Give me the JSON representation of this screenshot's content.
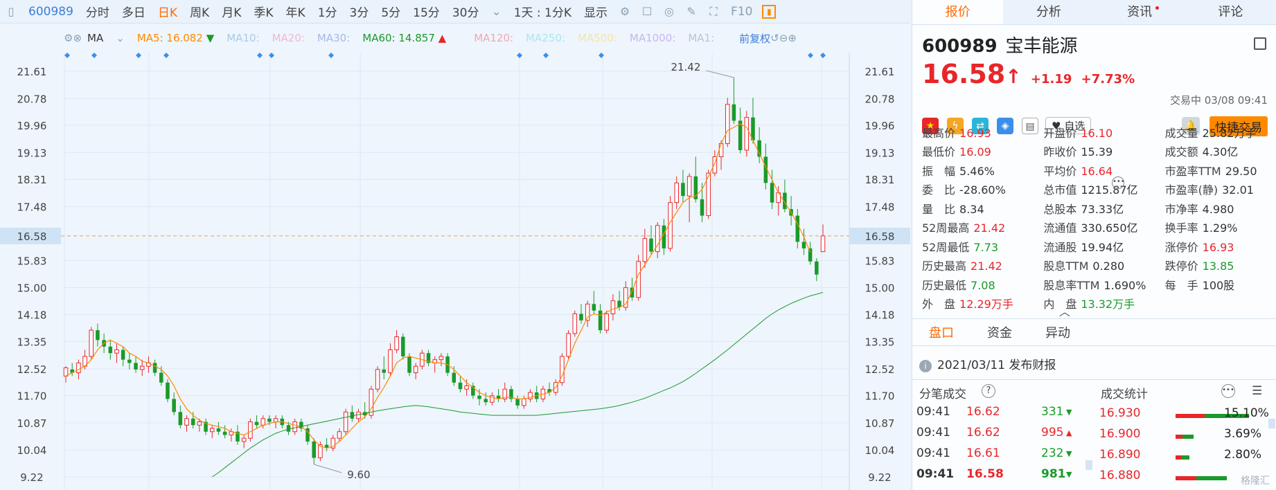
{
  "toolbar": {
    "code": "600989",
    "tabs": [
      "分时",
      "多日",
      "日K",
      "周K",
      "月K",
      "季K",
      "年K",
      "1分",
      "3分",
      "5分",
      "15分",
      "30分"
    ],
    "active": "日K",
    "range": "1天 : 1分K",
    "display": "显示",
    "f10": "F10"
  },
  "ma": {
    "label": "MA",
    "ma5": {
      "label": "MA5:",
      "value": "16.082",
      "color": "#ff8a00"
    },
    "ma10": "MA10:",
    "ma20": "MA20:",
    "ma30": "MA30:",
    "ma60": {
      "label": "MA60:",
      "value": "14.857",
      "color": "#1a9a2a"
    },
    "ma120": "MA120:",
    "ma250": "MA250:",
    "ma500": "MA500:",
    "ma1000": "MA1000:",
    "ma1": "MA1:",
    "adjust": "前复权"
  },
  "axis": {
    "levels": [
      "21.61",
      "20.78",
      "19.96",
      "19.13",
      "18.31",
      "17.48",
      "16.58",
      "15.83",
      "15.00",
      "14.18",
      "13.35",
      "12.52",
      "11.70",
      "10.87",
      "10.04",
      "9.22"
    ],
    "current": "16.58",
    "high_mark": "21.42",
    "low_mark": "9.60"
  },
  "chart_data": {
    "type": "candlestick",
    "symbol": "600989",
    "y_range": [
      9.22,
      21.61
    ],
    "current_price": 16.58,
    "annotations": {
      "max": 21.42,
      "min": 9.6
    },
    "candles": [
      [
        12.3,
        12.6,
        12.1,
        12.55
      ],
      [
        12.5,
        12.7,
        12.3,
        12.4
      ],
      [
        12.4,
        12.8,
        12.2,
        12.7
      ],
      [
        12.6,
        13.1,
        12.5,
        12.9
      ],
      [
        12.9,
        13.8,
        12.8,
        13.7
      ],
      [
        13.7,
        13.9,
        13.2,
        13.4
      ],
      [
        13.4,
        13.6,
        13.0,
        13.2
      ],
      [
        13.2,
        13.4,
        12.8,
        13.0
      ],
      [
        13.0,
        13.3,
        12.7,
        13.1
      ],
      [
        13.1,
        13.2,
        12.6,
        12.8
      ],
      [
        12.8,
        13.0,
        12.5,
        12.7
      ],
      [
        12.7,
        12.9,
        12.4,
        12.5
      ],
      [
        12.5,
        12.8,
        12.3,
        12.6
      ],
      [
        12.6,
        12.9,
        12.4,
        12.7
      ],
      [
        12.7,
        12.8,
        12.3,
        12.4
      ],
      [
        12.4,
        12.6,
        12.0,
        12.1
      ],
      [
        12.1,
        12.2,
        11.5,
        11.6
      ],
      [
        11.6,
        11.8,
        11.1,
        11.2
      ],
      [
        11.2,
        11.4,
        10.7,
        10.8
      ],
      [
        10.8,
        11.1,
        10.6,
        11.0
      ],
      [
        11.0,
        11.2,
        10.7,
        10.8
      ],
      [
        10.8,
        11.0,
        10.6,
        10.9
      ],
      [
        10.9,
        11.0,
        10.5,
        10.6
      ],
      [
        10.6,
        10.8,
        10.4,
        10.7
      ],
      [
        10.7,
        10.9,
        10.5,
        10.6
      ],
      [
        10.6,
        10.8,
        10.4,
        10.5
      ],
      [
        10.5,
        10.7,
        10.3,
        10.6
      ],
      [
        10.6,
        10.8,
        10.2,
        10.3
      ],
      [
        10.3,
        10.5,
        10.1,
        10.4
      ],
      [
        10.4,
        11.0,
        10.3,
        10.9
      ],
      [
        10.9,
        11.1,
        10.7,
        10.8
      ],
      [
        10.8,
        11.1,
        10.7,
        11.0
      ],
      [
        11.0,
        11.1,
        10.8,
        10.9
      ],
      [
        10.9,
        11.1,
        10.7,
        11.0
      ],
      [
        11.0,
        11.1,
        10.7,
        10.8
      ],
      [
        10.8,
        10.9,
        10.5,
        10.6
      ],
      [
        10.6,
        11.0,
        10.5,
        10.9
      ],
      [
        10.9,
        11.0,
        10.6,
        10.7
      ],
      [
        10.7,
        10.8,
        10.2,
        10.3
      ],
      [
        10.3,
        10.4,
        9.6,
        9.8
      ],
      [
        9.8,
        10.3,
        9.7,
        10.2
      ],
      [
        10.2,
        10.4,
        10.0,
        10.1
      ],
      [
        10.1,
        10.5,
        10.0,
        10.4
      ],
      [
        10.4,
        10.7,
        10.3,
        10.6
      ],
      [
        10.6,
        11.3,
        10.5,
        11.2
      ],
      [
        11.2,
        11.4,
        10.9,
        11.0
      ],
      [
        11.0,
        11.3,
        10.9,
        11.2
      ],
      [
        11.2,
        11.5,
        11.0,
        11.1
      ],
      [
        11.1,
        12.0,
        11.0,
        11.9
      ],
      [
        11.9,
        12.6,
        11.8,
        12.5
      ],
      [
        12.5,
        12.9,
        12.2,
        12.4
      ],
      [
        12.4,
        13.3,
        12.3,
        13.1
      ],
      [
        13.1,
        13.7,
        13.0,
        13.5
      ],
      [
        13.5,
        13.6,
        12.8,
        12.9
      ],
      [
        12.9,
        13.0,
        12.3,
        12.4
      ],
      [
        12.4,
        12.7,
        12.2,
        12.6
      ],
      [
        12.6,
        13.1,
        12.5,
        13.0
      ],
      [
        13.0,
        13.1,
        12.6,
        12.7
      ],
      [
        12.7,
        12.9,
        12.4,
        12.8
      ],
      [
        12.8,
        13.0,
        12.6,
        12.9
      ],
      [
        12.9,
        13.0,
        12.3,
        12.4
      ],
      [
        12.4,
        12.6,
        12.0,
        12.1
      ],
      [
        12.1,
        12.3,
        11.8,
        11.9
      ],
      [
        11.9,
        12.2,
        11.7,
        12.0
      ],
      [
        12.0,
        12.1,
        11.6,
        11.7
      ],
      [
        11.7,
        11.9,
        11.4,
        11.6
      ],
      [
        11.6,
        11.8,
        11.4,
        11.5
      ],
      [
        11.5,
        11.8,
        11.4,
        11.7
      ],
      [
        11.7,
        11.9,
        11.5,
        11.6
      ],
      [
        11.6,
        12.1,
        11.5,
        11.9
      ],
      [
        11.9,
        12.0,
        11.5,
        11.6
      ],
      [
        11.6,
        11.7,
        11.3,
        11.4
      ],
      [
        11.4,
        11.7,
        11.3,
        11.6
      ],
      [
        11.6,
        11.9,
        11.5,
        11.8
      ],
      [
        11.8,
        12.0,
        11.5,
        11.6
      ],
      [
        11.6,
        12.0,
        11.5,
        11.9
      ],
      [
        11.9,
        12.1,
        11.7,
        11.8
      ],
      [
        11.8,
        12.2,
        11.7,
        12.1
      ],
      [
        12.1,
        13.0,
        12.0,
        12.9
      ],
      [
        12.9,
        13.7,
        12.8,
        13.6
      ],
      [
        13.6,
        14.3,
        13.5,
        14.2
      ],
      [
        14.2,
        14.5,
        13.9,
        14.0
      ],
      [
        14.0,
        14.6,
        13.8,
        14.5
      ],
      [
        14.5,
        14.9,
        14.2,
        14.3
      ],
      [
        14.3,
        14.5,
        13.6,
        13.7
      ],
      [
        13.7,
        14.3,
        13.6,
        14.2
      ],
      [
        14.2,
        14.8,
        14.0,
        14.6
      ],
      [
        14.6,
        14.9,
        14.3,
        14.4
      ],
      [
        14.4,
        15.2,
        14.3,
        15.0
      ],
      [
        15.0,
        15.3,
        14.6,
        14.7
      ],
      [
        14.7,
        16.0,
        14.6,
        15.8
      ],
      [
        15.8,
        16.8,
        15.6,
        16.5
      ],
      [
        16.5,
        16.9,
        16.0,
        16.1
      ],
      [
        16.1,
        17.0,
        15.9,
        16.9
      ],
      [
        16.9,
        17.1,
        16.0,
        16.2
      ],
      [
        16.2,
        17.8,
        16.1,
        17.6
      ],
      [
        17.6,
        18.4,
        17.4,
        18.2
      ],
      [
        18.2,
        18.6,
        17.6,
        17.8
      ],
      [
        17.8,
        18.5,
        17.0,
        18.4
      ],
      [
        18.4,
        19.0,
        17.6,
        17.7
      ],
      [
        17.7,
        18.2,
        17.0,
        17.2
      ],
      [
        17.2,
        18.6,
        17.1,
        18.5
      ],
      [
        18.5,
        19.2,
        18.4,
        19.0
      ],
      [
        19.0,
        19.5,
        18.6,
        19.4
      ],
      [
        19.4,
        20.8,
        19.3,
        20.6
      ],
      [
        20.6,
        21.42,
        20.0,
        20.1
      ],
      [
        20.1,
        20.5,
        19.1,
        19.2
      ],
      [
        19.2,
        20.4,
        19.0,
        20.2
      ],
      [
        20.2,
        20.8,
        19.4,
        19.5
      ],
      [
        19.5,
        19.9,
        18.8,
        19.0
      ],
      [
        19.0,
        19.4,
        18.0,
        18.2
      ],
      [
        18.2,
        18.6,
        17.4,
        17.6
      ],
      [
        17.6,
        18.1,
        17.2,
        17.9
      ],
      [
        17.9,
        18.3,
        17.3,
        17.4
      ],
      [
        17.4,
        17.8,
        16.9,
        17.2
      ],
      [
        17.2,
        17.4,
        16.2,
        16.4
      ],
      [
        16.4,
        16.8,
        16.0,
        16.2
      ],
      [
        16.2,
        16.4,
        15.7,
        15.8
      ],
      [
        15.8,
        15.9,
        15.2,
        15.4
      ],
      [
        16.1,
        16.93,
        16.09,
        16.58
      ]
    ],
    "ma5": [
      12.3,
      12.4,
      12.5,
      12.6,
      12.8,
      13.1,
      13.3,
      13.4,
      13.3,
      13.2,
      13.0,
      12.9,
      12.75,
      12.7,
      12.6,
      12.5,
      12.3,
      12.0,
      11.6,
      11.3,
      11.1,
      10.95,
      10.85,
      10.8,
      10.75,
      10.7,
      10.6,
      10.55,
      10.5,
      10.6,
      10.7,
      10.8,
      10.85,
      10.9,
      10.9,
      10.85,
      10.8,
      10.75,
      10.6,
      10.35,
      10.15,
      10.1,
      10.15,
      10.3,
      10.5,
      10.7,
      10.9,
      11.05,
      11.3,
      11.65,
      11.95,
      12.3,
      12.7,
      12.85,
      12.9,
      12.85,
      12.8,
      12.75,
      12.7,
      12.7,
      12.65,
      12.5,
      12.3,
      12.1,
      11.95,
      11.8,
      11.7,
      11.65,
      11.6,
      11.65,
      11.65,
      11.6,
      11.6,
      11.65,
      11.7,
      11.75,
      11.8,
      11.95,
      12.3,
      12.8,
      13.3,
      13.7,
      14.1,
      14.2,
      14.15,
      14.25,
      14.35,
      14.4,
      14.5,
      14.9,
      15.4,
      15.7,
      16.0,
      16.3,
      16.65,
      17.0,
      17.3,
      17.6,
      17.75,
      17.8,
      18.0,
      18.4,
      18.8,
      19.4,
      19.8,
      19.9,
      20.0,
      19.9,
      19.5,
      19.1,
      18.7,
      18.3,
      17.9,
      17.6,
      17.3,
      16.95,
      16.55,
      16.08
    ],
    "ma60": [
      9.22,
      9.35,
      9.5,
      9.65,
      9.8,
      9.95,
      10.1,
      10.22,
      10.35,
      10.45,
      10.55,
      10.62,
      10.68,
      10.72,
      10.76,
      10.8,
      10.84,
      10.88,
      10.92,
      10.96,
      11.0,
      11.04,
      11.08,
      11.12,
      11.16,
      11.2,
      11.24,
      11.27,
      11.3,
      11.33,
      11.36,
      11.38,
      11.4,
      11.38,
      11.36,
      11.33,
      11.3,
      11.27,
      11.24,
      11.2,
      11.18,
      11.16,
      11.14,
      11.12,
      11.1,
      11.1,
      11.1,
      11.1,
      11.1,
      11.1,
      11.1,
      11.1,
      11.12,
      11.14,
      11.16,
      11.18,
      11.2,
      11.22,
      11.24,
      11.26,
      11.28,
      11.3,
      11.33,
      11.36,
      11.4,
      11.45,
      11.5,
      11.56,
      11.62,
      11.7,
      11.78,
      11.86,
      11.94,
      12.03,
      12.13,
      12.25,
      12.38,
      12.52,
      12.66,
      12.8,
      12.95,
      13.1,
      13.26,
      13.42,
      13.58,
      13.74,
      13.9,
      14.06,
      14.2,
      14.32,
      14.42,
      14.52,
      14.6,
      14.68,
      14.75,
      14.8,
      14.857
    ]
  },
  "quote": {
    "code": "600989",
    "name": "宝丰能源",
    "price": "16.58",
    "arrow": "↑",
    "change": "+1.19",
    "pct": "+7.73%",
    "status": "交易中 03/08 09:41",
    "watch": "自选",
    "quick": "快捷交易"
  },
  "tabs": [
    "报价",
    "分析",
    "资讯",
    "评论"
  ],
  "stats": [
    [
      [
        "最高价",
        "16.93",
        "red"
      ],
      [
        "开盘价",
        "16.10",
        "red"
      ],
      [
        "成交量",
        "25.82万手",
        "dark"
      ]
    ],
    [
      [
        "最低价",
        "16.09",
        "red"
      ],
      [
        "昨收价",
        "15.39",
        "dark"
      ],
      [
        "成交额",
        "4.30亿",
        "dark"
      ]
    ],
    [
      [
        "振　幅",
        "5.46%",
        "dark"
      ],
      [
        "平均价",
        "16.64",
        "red"
      ],
      [
        "市盈率TTM",
        "29.50",
        "dark"
      ]
    ],
    [
      [
        "委　比",
        "-28.60%",
        "dark"
      ],
      [
        "总市值",
        "1215.87亿",
        "dark"
      ],
      [
        "市盈率(静)",
        "32.01",
        "dark"
      ]
    ],
    [
      [
        "量　比",
        "8.34",
        "dark"
      ],
      [
        "总股本",
        "73.33亿",
        "dark"
      ],
      [
        "市净率",
        "4.980",
        "dark"
      ]
    ],
    [
      [
        "52周最高",
        "21.42",
        "red"
      ],
      [
        "流通值",
        "330.650亿",
        "dark"
      ],
      [
        "换手率",
        "1.29%",
        "dark"
      ]
    ],
    [
      [
        "52周最低",
        "7.73",
        "green"
      ],
      [
        "流通股",
        "19.94亿",
        "dark"
      ],
      [
        "涨停价",
        "16.93",
        "red"
      ]
    ],
    [
      [
        "历史最高",
        "21.42",
        "red"
      ],
      [
        "股息TTM",
        "0.280",
        "dark"
      ],
      [
        "跌停价",
        "13.85",
        "green"
      ]
    ],
    [
      [
        "历史最低",
        "7.08",
        "green"
      ],
      [
        "股息率TTM",
        "1.690%",
        "dark"
      ],
      [
        "每　手",
        "100股",
        "dark"
      ]
    ],
    [
      [
        "外　盘",
        "12.29万手",
        "red"
      ],
      [
        "内　盘",
        "13.32万手",
        "green"
      ],
      [
        "",
        "",
        " "
      ]
    ]
  ],
  "subtabs": [
    "盘口",
    "资金",
    "异动"
  ],
  "notice": "2021/03/11  发布财报",
  "trades_title": "分笔成交",
  "stats_title": "成交统计",
  "trades": [
    [
      "09:41",
      "16.62",
      "331",
      "down"
    ],
    [
      "09:41",
      "16.62",
      "995",
      "up"
    ],
    [
      "09:41",
      "16.61",
      "232",
      "down"
    ],
    [
      "09:41",
      "16.58",
      "981",
      "down"
    ]
  ],
  "dist": [
    [
      "16.930",
      "15.10%",
      0.88
    ],
    [
      "16.900",
      "3.69%",
      0.22
    ],
    [
      "16.890",
      "2.80%",
      0.17
    ],
    [
      "16.880",
      "",
      0.62
    ]
  ],
  "watermark": "格隆汇"
}
